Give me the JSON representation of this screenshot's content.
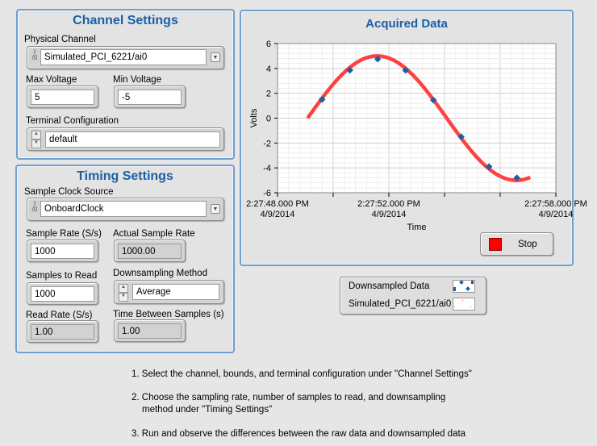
{
  "channel_settings": {
    "title": "Channel Settings",
    "physical_channel": {
      "label": "Physical Channel",
      "value": "Simulated_PCI_6221/ai0"
    },
    "max_voltage": {
      "label": "Max Voltage",
      "value": "5"
    },
    "min_voltage": {
      "label": "Min Voltage",
      "value": "-5"
    },
    "terminal_configuration": {
      "label": "Terminal Configuration",
      "value": "default"
    }
  },
  "timing_settings": {
    "title": "Timing Settings",
    "sample_clock_source": {
      "label": "Sample Clock Source",
      "value": "OnboardClock"
    },
    "sample_rate": {
      "label": "Sample Rate (S/s)",
      "value": "1000"
    },
    "actual_sample_rate": {
      "label": "Actual Sample Rate",
      "value": "1000.00"
    },
    "samples_to_read": {
      "label": "Samples to Read",
      "value": "1000"
    },
    "downsampling_method": {
      "label": "Downsampling Method",
      "value": "Average"
    },
    "read_rate": {
      "label": "Read Rate (S/s)",
      "value": "1.00"
    },
    "time_between_samples": {
      "label": "Time Between Samples (s)",
      "value": "1.00"
    }
  },
  "graph": {
    "title": "Acquired Data",
    "stop_label": "Stop"
  },
  "legend": {
    "items": [
      {
        "name": "Downsampled Data",
        "color": "#1f5fa0"
      },
      {
        "name": "Simulated_PCI_6221/ai0",
        "color": "#ff4040"
      }
    ]
  },
  "instructions": [
    "1. Select the channel, bounds, and terminal configuration under \"Channel Settings\"",
    "2. Choose the sampling rate, number of samples to read, and downsampling",
    "method under \"Timing Settings\"",
    "3. Run and observe the differences between the raw data and downsampled data"
  ],
  "chart_data": {
    "type": "line",
    "title": "Acquired Data",
    "xlabel": "Time",
    "ylabel": "Volts",
    "xlim": [
      "2:27:48.000 PM",
      "2:27:58.000 PM"
    ],
    "ylim": [
      -6,
      6
    ],
    "grid": true,
    "x_tick_labels": [
      [
        "2:27:48.000 PM",
        "4/9/2014"
      ],
      [
        "2:27:52.000 PM",
        "4/9/2014"
      ],
      [
        "2:27:58.000 PM",
        "4/9/2014"
      ]
    ],
    "x_tick_seconds": [
      48,
      52,
      58
    ],
    "x_ticks_all": [
      48,
      50,
      52,
      54,
      56,
      58
    ],
    "y_ticks": [
      -6,
      -4,
      -2,
      0,
      2,
      4,
      6
    ],
    "series": [
      {
        "name": "Simulated_PCI_6221/ai0",
        "style": "line",
        "color": "#ff4040",
        "amplitude": 5,
        "period_s": 10,
        "start_s": 49.08,
        "end_s": 57.1
      },
      {
        "name": "Downsampled Data",
        "style": "points",
        "color": "#1f5fa0",
        "x_s": [
          49.6,
          50.6,
          51.6,
          52.6,
          53.6,
          54.6,
          55.6,
          56.6
        ],
        "y": [
          1.5,
          3.85,
          4.75,
          3.85,
          1.45,
          -1.5,
          -3.9,
          -4.8
        ]
      }
    ]
  }
}
